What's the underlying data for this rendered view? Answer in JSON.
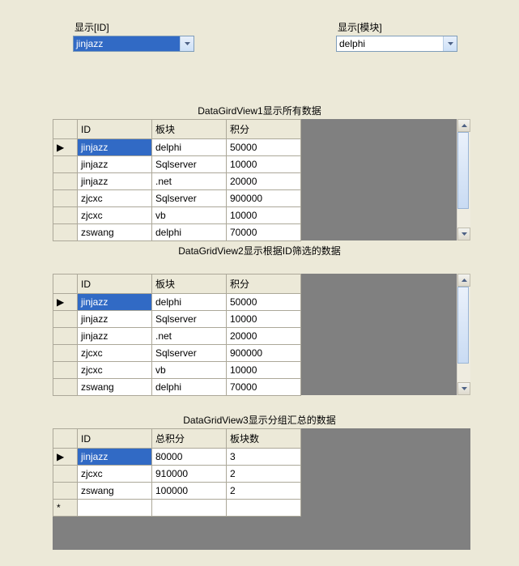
{
  "combos": {
    "id": {
      "label": "显示[ID]",
      "value": "jinjazz",
      "selected": true
    },
    "module": {
      "label": "显示[模块]",
      "value": "delphi",
      "selected": false
    }
  },
  "captions": {
    "grid1": "DataGirdView1显示所有数据",
    "grid2": "DataGridView2显示根据ID筛选的数据",
    "grid3": "DataGridView3显示分组汇总的数据"
  },
  "headers": {
    "id": "ID",
    "board": "板块",
    "score": "积分",
    "total": "总积分",
    "boardCount": "板块数"
  },
  "rowmarkers": {
    "current": "▶",
    "new": "*"
  },
  "grid1": [
    {
      "id": "jinjazz",
      "board": "delphi",
      "score": "50000"
    },
    {
      "id": "jinjazz",
      "board": "Sqlserver",
      "score": "10000"
    },
    {
      "id": "jinjazz",
      "board": ".net",
      "score": "20000"
    },
    {
      "id": "zjcxc",
      "board": "Sqlserver",
      "score": "900000"
    },
    {
      "id": "zjcxc",
      "board": "vb",
      "score": "10000"
    },
    {
      "id": "zswang",
      "board": "delphi",
      "score": "70000"
    }
  ],
  "grid2": [
    {
      "id": "jinjazz",
      "board": "delphi",
      "score": "50000"
    },
    {
      "id": "jinjazz",
      "board": "Sqlserver",
      "score": "10000"
    },
    {
      "id": "jinjazz",
      "board": ".net",
      "score": "20000"
    },
    {
      "id": "zjcxc",
      "board": "Sqlserver",
      "score": "900000"
    },
    {
      "id": "zjcxc",
      "board": "vb",
      "score": "10000"
    },
    {
      "id": "zswang",
      "board": "delphi",
      "score": "70000"
    }
  ],
  "grid3": [
    {
      "id": "jinjazz",
      "total": "80000",
      "boardCount": "3"
    },
    {
      "id": "zjcxc",
      "total": "910000",
      "boardCount": "2"
    },
    {
      "id": "zswang",
      "total": "100000",
      "boardCount": "2"
    }
  ]
}
